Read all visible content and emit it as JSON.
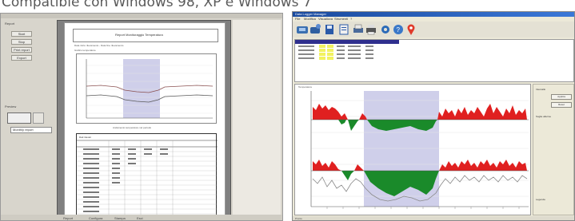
{
  "headline": "Compatible con Windows 98, XP e Windows 7",
  "left_window": {
    "panel_header": "Report",
    "buttons": [
      "Start",
      "Stop",
      "Print report",
      "Export"
    ],
    "preview_label": "Preview",
    "select_value": "Monthly report",
    "document": {
      "title": "Report Monitoraggio Temperatura",
      "subtitle": "Data inizio rilevamento - Data fine rilevamento",
      "section": "Grafico temperature",
      "chart_caption": "Andamento temperature nel periodo",
      "table_title": "Dati rilevati"
    },
    "status_items": [
      "Report",
      "Configura",
      "Stampa",
      "Esci"
    ]
  },
  "right_window": {
    "title": "Data Logger Manager",
    "menu": [
      "File",
      "Modifica",
      "Visualizza",
      "Strumenti",
      "?"
    ],
    "toolbar_icons": [
      "download-icon",
      "logger-icon",
      "save-icon",
      "document-icon",
      "print-icon",
      "printer-icon",
      "settings-icon",
      "help-icon",
      "location-icon"
    ],
    "chart_label": "Temperatura",
    "side_panel": {
      "label_1": "Intervallo",
      "button_1": "Applica",
      "button_2": "Reset",
      "label_2": "Soglie allarme",
      "label_3": "Legenda"
    },
    "status": "Pronto"
  },
  "colors": {
    "area_above": "#e02020",
    "area_below": "#1a8a2a",
    "highlight": "#c8c8e8",
    "selection_row": "#f2f260",
    "title_bar": "#1a4a9e"
  }
}
